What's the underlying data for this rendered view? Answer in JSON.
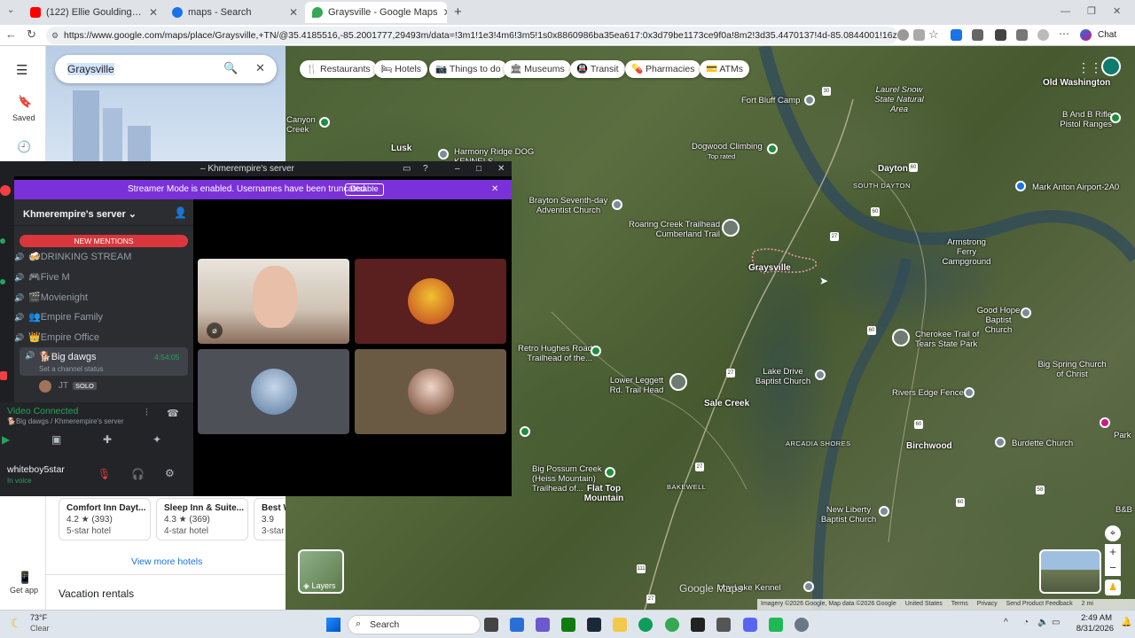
{
  "browser": {
    "tabs": [
      {
        "title": "(122) Ellie Goulding - Lights (Offici",
        "favicon_color": "#ff0000"
      },
      {
        "title": "maps - Search",
        "favicon_color": "#1a73e8"
      },
      {
        "title": "Graysville - Google Maps",
        "favicon_color": "#34a853"
      }
    ],
    "url": "https://www.google.com/maps/place/Graysville,+TN/@35.4185516,-85.2001777,29493m/data=!3m1!1e3!4m6!3m5!1s0x8860986ba35ea617:0x3d79be1173ce9f0a!8m2!3d35.4470137!4d-85.0844001!16zL2dvMF93Z3I?entry...",
    "chat_label": "Chat",
    "window_controls": "— ❐ ✕"
  },
  "maps": {
    "search_value": "Graysville",
    "sidebar": {
      "saved_label": "Saved",
      "get_app_label": "Get app"
    },
    "chips": [
      "Restaurants",
      "Hotels",
      "Things to do",
      "Museums",
      "Transit",
      "Pharmacies",
      "ATMs"
    ],
    "hotels": [
      {
        "name": "Comfort Inn Dayt...",
        "rating": "4.2 ★ (393)",
        "class": "5-star hotel"
      },
      {
        "name": "Sleep Inn & Suite...",
        "rating": "4.3 ★ (369)",
        "class": "4-star hotel"
      },
      {
        "name": "Best W",
        "rating": "3.9",
        "class": "3-star"
      }
    ],
    "view_more_hotels": "View more hotels",
    "vacation_rentals": "Vacation rentals",
    "layers_label": "Layers",
    "watermark": "Google Maps",
    "footer": {
      "imagery": "Imagery ©2026 Google, Map data ©2026 Google",
      "country": "United States",
      "terms": "Terms",
      "privacy": "Privacy",
      "feedback": "Send Product Feedback",
      "scale": "2 mi"
    },
    "labels": [
      {
        "text": "Old Washington",
        "kind": "town"
      },
      {
        "text": "Fort Bluff Camp",
        "kind": "poi"
      },
      {
        "text": "Laurel Snow State Natural Area",
        "kind": "poi"
      },
      {
        "text": "B And B Rifle Pistol Ranges",
        "kind": "poi"
      },
      {
        "text": "Canyon Creek",
        "kind": "poi"
      },
      {
        "text": "Lusk",
        "kind": "town"
      },
      {
        "text": "Harmony Ridge DOG KENNELS",
        "kind": "poi"
      },
      {
        "text": "Dogwood Climbing",
        "kind": "poi"
      },
      {
        "text": "Top rated",
        "kind": "sub"
      },
      {
        "text": "Dayton",
        "kind": "town"
      },
      {
        "text": "SOUTH DAYTON",
        "kind": "area"
      },
      {
        "text": "Mark Anton Airport-2A0",
        "kind": "poi"
      },
      {
        "text": "Brayton Seventh-day Adventist Church",
        "kind": "poi"
      },
      {
        "text": "Roaring Creek Trailhead Cumberland Trail",
        "kind": "poi"
      },
      {
        "text": "Graysville",
        "kind": "town"
      },
      {
        "text": "Armstrong Ferry Campground",
        "kind": "poi"
      },
      {
        "text": "Good Hope Baptist Church",
        "kind": "poi"
      },
      {
        "text": "Cherokee Trail of Tears State Park",
        "kind": "poi"
      },
      {
        "text": "Retro Hughes Road Trailhead of the...",
        "kind": "poi"
      },
      {
        "text": "Lake Drive Baptist Church",
        "kind": "poi"
      },
      {
        "text": "Big Spring Church of Christ",
        "kind": "poi"
      },
      {
        "text": "Lower Leggett Rd. Trail Head",
        "kind": "poi"
      },
      {
        "text": "Sale Creek",
        "kind": "town"
      },
      {
        "text": "Rivers Edge Fence",
        "kind": "poi"
      },
      {
        "text": "Park",
        "kind": "poi"
      },
      {
        "text": "ARCADIA SHORES",
        "kind": "area"
      },
      {
        "text": "Birchwood",
        "kind": "town"
      },
      {
        "text": "Burdette Church",
        "kind": "poi"
      },
      {
        "text": "Big Possum Creek (Heiss Mountain) Trailhead of...",
        "kind": "poi"
      },
      {
        "text": "Flat Top Mountain",
        "kind": "town"
      },
      {
        "text": "BAKEWELL",
        "kind": "area"
      },
      {
        "text": "New Liberty Baptist Church",
        "kind": "poi"
      },
      {
        "text": "B&B",
        "kind": "poi"
      },
      {
        "text": "bby Lake Kennel",
        "kind": "poi"
      }
    ],
    "shields": [
      "30",
      "60",
      "27",
      "60",
      "60",
      "27",
      "27",
      "60",
      "60",
      "58",
      "27",
      "111"
    ]
  },
  "discord": {
    "window_title": "Khmerempire's server",
    "banner_text": "Streamer Mode is enabled. Usernames have been truncated.",
    "banner_button": "Disable",
    "server_name": "Khmerempire's server",
    "new_mentions": "NEW MENTIONS",
    "channels": [
      {
        "name": "🍻DRINKING STREAM"
      },
      {
        "name": "🎮Five M"
      },
      {
        "name": "🎬Movienight"
      },
      {
        "name": "👥Empire Family"
      },
      {
        "name": "👑Empire Office"
      }
    ],
    "active_channel": {
      "name": "🐕Big dawgs",
      "timer": "4:54:05",
      "status": "Set a channel status"
    },
    "voice_user": {
      "name": "JT",
      "badge": "SOLO"
    },
    "voice_status": {
      "label": "Video Connected",
      "location": "🐕Big dawgs / Khmerempire's server"
    },
    "user": {
      "name": "whiteboy5star",
      "status": "In voice"
    }
  },
  "taskbar": {
    "weather": {
      "temp": "73°F",
      "condition": "Clear"
    },
    "search_label": "Search",
    "time": "2:49 AM",
    "date": "8/31/2026"
  }
}
